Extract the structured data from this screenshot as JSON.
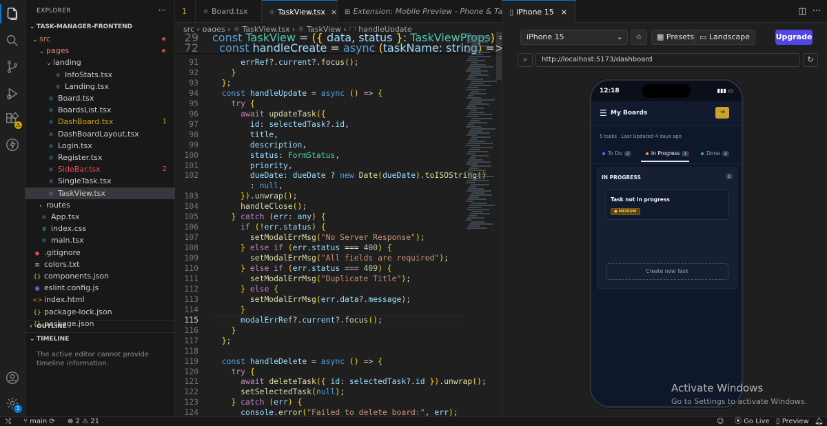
{
  "sidebar": {
    "title": "EXPLORER",
    "more": "···",
    "project": "TASK-MANAGER-FRONTEND",
    "tree": [
      {
        "label": "src",
        "kind": "folder",
        "open": true,
        "indent": 0,
        "color": "#e2826f",
        "mark": "dot"
      },
      {
        "label": "pages",
        "kind": "folder",
        "open": true,
        "indent": 1,
        "color": "#e2826f",
        "mark": "dot"
      },
      {
        "label": "landing",
        "kind": "folder",
        "open": true,
        "indent": 2,
        "color": "#cccccc",
        "mark": ""
      },
      {
        "label": "InfoStats.tsx",
        "kind": "tsx",
        "indent": 3,
        "color": "#cccccc",
        "mark": ""
      },
      {
        "label": "Landing.tsx",
        "kind": "tsx",
        "indent": 3,
        "color": "#cccccc",
        "mark": ""
      },
      {
        "label": "Board.tsx",
        "kind": "tsx",
        "indent": 2,
        "color": "#cccccc",
        "mark": ""
      },
      {
        "label": "BoardsList.tsx",
        "kind": "tsx",
        "indent": 2,
        "color": "#cccccc",
        "mark": ""
      },
      {
        "label": "DashBoard.tsx",
        "kind": "tsx",
        "indent": 2,
        "color": "#cca700",
        "mark": "1"
      },
      {
        "label": "DashBoardLayout.tsx",
        "kind": "tsx",
        "indent": 2,
        "color": "#cccccc",
        "mark": ""
      },
      {
        "label": "Login.tsx",
        "kind": "tsx",
        "indent": 2,
        "color": "#cccccc",
        "mark": ""
      },
      {
        "label": "Register.tsx",
        "kind": "tsx",
        "indent": 2,
        "color": "#cccccc",
        "mark": ""
      },
      {
        "label": "SideBar.tsx",
        "kind": "tsx",
        "indent": 2,
        "color": "#f14c4c",
        "mark": "2"
      },
      {
        "label": "SingleTask.tsx",
        "kind": "tsx",
        "indent": 2,
        "color": "#cccccc",
        "mark": ""
      },
      {
        "label": "TaskView.tsx",
        "kind": "tsx",
        "indent": 2,
        "color": "#cccccc",
        "mark": "",
        "selected": true
      },
      {
        "label": "routes",
        "kind": "folder",
        "open": false,
        "indent": 1,
        "color": "#cccccc",
        "mark": ""
      },
      {
        "label": "App.tsx",
        "kind": "tsx",
        "indent": 1,
        "color": "#cccccc",
        "mark": ""
      },
      {
        "label": "index.css",
        "kind": "css",
        "indent": 1,
        "color": "#cccccc",
        "mark": ""
      },
      {
        "label": "main.tsx",
        "kind": "tsx",
        "indent": 1,
        "color": "#cccccc",
        "mark": ""
      },
      {
        "label": ".gitignore",
        "kind": "git",
        "indent": 0,
        "color": "#cccccc",
        "mark": ""
      },
      {
        "label": "colors.txt",
        "kind": "txt",
        "indent": 0,
        "color": "#cccccc",
        "mark": ""
      },
      {
        "label": "components.json",
        "kind": "json",
        "indent": 0,
        "color": "#cccccc",
        "mark": ""
      },
      {
        "label": "eslint.config.js",
        "kind": "eslint",
        "indent": 0,
        "color": "#cccccc",
        "mark": ""
      },
      {
        "label": "index.html",
        "kind": "html",
        "indent": 0,
        "color": "#cccccc",
        "mark": ""
      },
      {
        "label": "package-lock.json",
        "kind": "json",
        "indent": 0,
        "color": "#cccccc",
        "mark": ""
      },
      {
        "label": "package.json",
        "kind": "json",
        "indent": 0,
        "color": "#cccccc",
        "mark": ""
      }
    ],
    "outline": "OUTLINE",
    "timeline": "TIMELINE",
    "timeline_msg": "The active editor cannot provide timeline information."
  },
  "editor": {
    "tabs": [
      {
        "label": "1",
        "icon": ""
      },
      {
        "label": "Board.tsx",
        "icon": "⚛"
      },
      {
        "label": "TaskView.tsx",
        "icon": "⚛"
      },
      {
        "label": "Extension: Mobile Preview - Phone & Tablet",
        "icon": "⊞"
      }
    ],
    "breadcrumb": [
      "src",
      "pages",
      "TaskView.tsx",
      "TaskView",
      "handleUpdate"
    ],
    "sticky": [
      {
        "n": "29",
        "code": "const TaskView = ({ data, status }: TaskViewProps) => {"
      },
      {
        "n": "72",
        "code": "  const handleCreate = async (taskName: string) => {"
      }
    ],
    "lines": [
      {
        "n": "91",
        "code": "      errRef?.current?.focus();"
      },
      {
        "n": "92",
        "code": "    }"
      },
      {
        "n": "93",
        "code": "  };"
      },
      {
        "n": "94",
        "code": "  const handleUpdate = async () => {"
      },
      {
        "n": "95",
        "code": "    try {"
      },
      {
        "n": "96",
        "code": "      await updateTask({"
      },
      {
        "n": "97",
        "code": "        id: selectedTask?.id,"
      },
      {
        "n": "98",
        "code": "        title,"
      },
      {
        "n": "99",
        "code": "        description,"
      },
      {
        "n": "100",
        "code": "        status: FormStatus,"
      },
      {
        "n": "101",
        "code": "        priority,"
      },
      {
        "n": "102",
        "code": "        dueDate: dueDate ? new Date(dueDate).toISOString()"
      },
      {
        "n": "",
        "code": "        : null,"
      },
      {
        "n": "103",
        "code": "      }).unwrap();"
      },
      {
        "n": "104",
        "code": "      handleClose();"
      },
      {
        "n": "105",
        "code": "    } catch (err: any) {"
      },
      {
        "n": "106",
        "code": "      if (!err.status) {"
      },
      {
        "n": "107",
        "code": "        setModalErrMsg(\"No Server Response\");"
      },
      {
        "n": "108",
        "code": "      } else if (err.status === 400) {"
      },
      {
        "n": "109",
        "code": "        setModalErrMsg(\"All fields are required\");"
      },
      {
        "n": "110",
        "code": "      } else if (err.status === 409) {"
      },
      {
        "n": "111",
        "code": "        setModalErrMsg(\"Duplicate Title\");"
      },
      {
        "n": "112",
        "code": "      } else {"
      },
      {
        "n": "113",
        "code": "        setModalErrMsg(err.data?.message);"
      },
      {
        "n": "114",
        "code": "      }"
      },
      {
        "n": "115",
        "code": "      modalErrRef?.current?.focus();",
        "current": true
      },
      {
        "n": "116",
        "code": "    }"
      },
      {
        "n": "117",
        "code": "  };"
      },
      {
        "n": "118",
        "code": ""
      },
      {
        "n": "119",
        "code": "  const handleDelete = async () => {"
      },
      {
        "n": "120",
        "code": "    try {"
      },
      {
        "n": "121",
        "code": "      await deleteTask({ id: selectedTask?.id }).unwrap();"
      },
      {
        "n": "122",
        "code": "      setSelectedTask(null);"
      },
      {
        "n": "123",
        "code": "    } catch (err) {"
      },
      {
        "n": "124",
        "code": "      console.error(\"Failed to delete board:\", err);"
      }
    ]
  },
  "preview": {
    "tab_label": "iPhone 15",
    "device": "iPhone 15",
    "presets": "Presets",
    "landscape": "Landscape",
    "upgrade": "Upgrade",
    "url": "http://localhost:5173/dashboard",
    "phone": {
      "time": "12:18",
      "title": "My Boards",
      "meta": "5 tasks . Last Updated 4 days ago",
      "tabs": [
        {
          "label": "To Do",
          "count": "2",
          "color": "#3b82f6"
        },
        {
          "label": "In Progress",
          "count": "1",
          "color": "#f59e0b"
        },
        {
          "label": "Done",
          "count": "2",
          "color": "#22c55e"
        }
      ],
      "column_title": "IN PROGRESS",
      "column_count": "1",
      "card_title": "Task not in progress",
      "card_badge": "● MEDIUM",
      "create": "Create new Task"
    },
    "watermark_title": "Activate Windows",
    "watermark_sub": "Go to Settings to activate Windows."
  },
  "status": {
    "branch": "main",
    "problems": "⊗ 2 ⚠ 21",
    "golive": "Go Live",
    "preview": "Preview"
  },
  "colors": {
    "accent": "#0078d4",
    "upgrade": "#4f46e5",
    "logout": "#c9a227"
  }
}
